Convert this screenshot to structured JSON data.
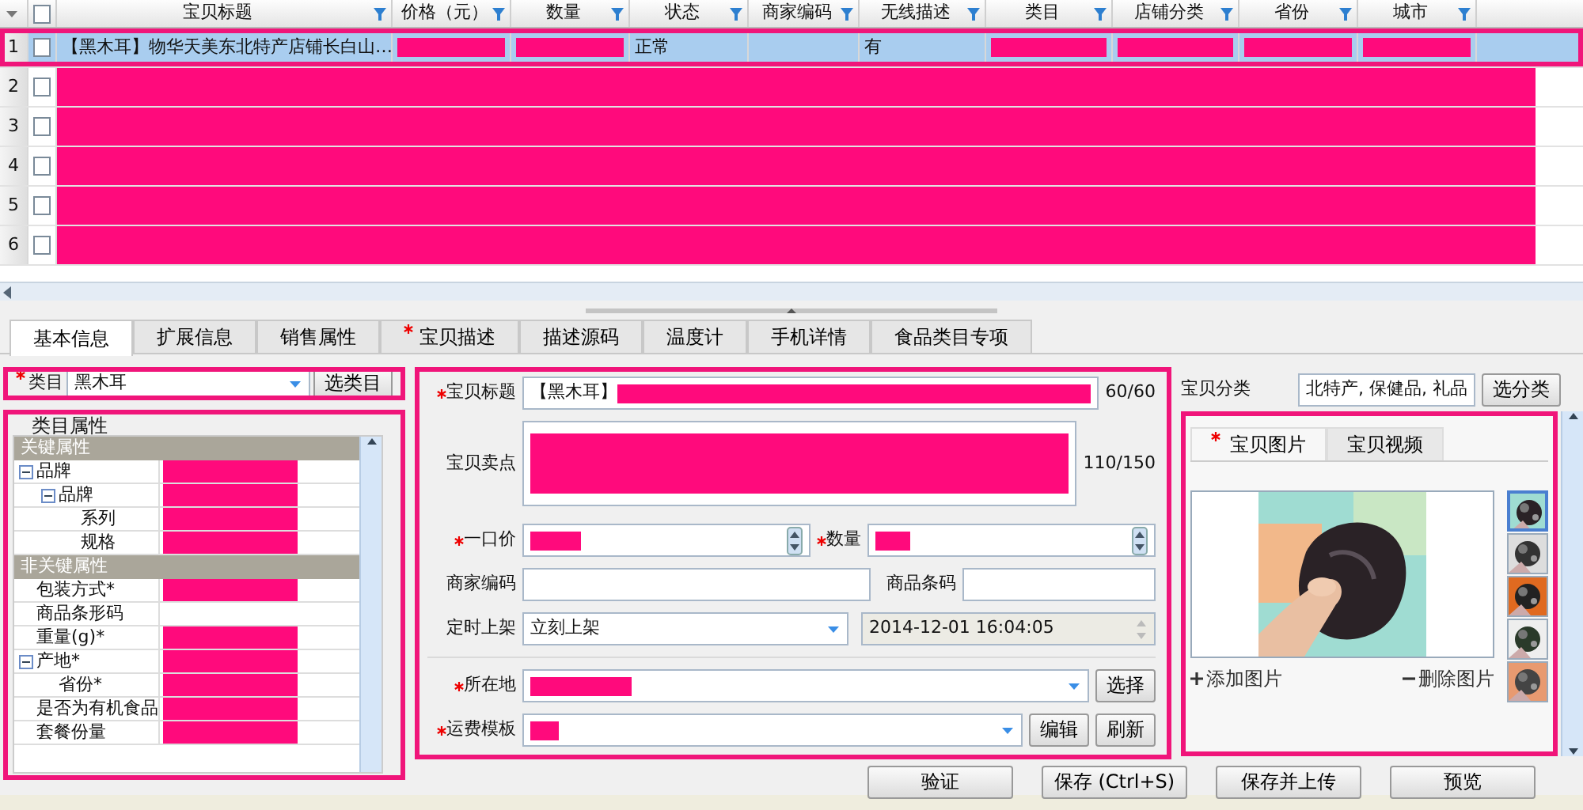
{
  "grid": {
    "select_all_checked": false,
    "columns": [
      "宝贝标题",
      "价格（元）",
      "数量",
      "状态",
      "商家编码",
      "无线描述",
      "类目",
      "店铺分类",
      "省份",
      "城市"
    ],
    "rows": [
      {
        "number": "1",
        "checked": false,
        "selected": true,
        "highlighted": true,
        "redacted": false,
        "cells": [
          {
            "text": "【黑木耳】物华天美东北特产店铺长白山…",
            "redacted": false
          },
          {
            "redacted": true
          },
          {
            "redacted": true
          },
          {
            "text": "正常",
            "redacted": false
          },
          {
            "redacted": false
          },
          {
            "text": "有",
            "redacted": false
          },
          {
            "redacted": true
          },
          {
            "redacted": true
          },
          {
            "redacted": true
          },
          {
            "redacted": true
          }
        ]
      },
      {
        "number": "2",
        "checked": false,
        "selected": false,
        "highlighted": false,
        "redacted": true
      },
      {
        "number": "3",
        "checked": false,
        "selected": false,
        "highlighted": false,
        "redacted": true
      },
      {
        "number": "4",
        "checked": false,
        "selected": false,
        "highlighted": false,
        "redacted": true
      },
      {
        "number": "5",
        "checked": false,
        "selected": false,
        "highlighted": false,
        "redacted": true
      },
      {
        "number": "6",
        "checked": false,
        "selected": false,
        "highlighted": false,
        "redacted": true
      }
    ]
  },
  "tabs": [
    {
      "label": "基本信息",
      "selected": true,
      "required": false
    },
    {
      "label": "扩展信息",
      "selected": false,
      "required": false
    },
    {
      "label": "销售属性",
      "selected": false,
      "required": false
    },
    {
      "label": "宝贝描述",
      "selected": false,
      "required": true
    },
    {
      "label": "描述源码",
      "selected": false,
      "required": false
    },
    {
      "label": "温度计",
      "selected": false,
      "required": false
    },
    {
      "label": "手机详情",
      "selected": false,
      "required": false
    },
    {
      "label": "食品类目专项",
      "selected": false,
      "required": false
    }
  ],
  "category_field": {
    "label": "类目",
    "required": true,
    "value": "黑木耳",
    "button": "选类目",
    "highlighted": true
  },
  "attributes": {
    "legend": "类目属性",
    "highlighted": true,
    "rows": [
      {
        "kind": "group",
        "label": "关键属性"
      },
      {
        "kind": "item",
        "label": "品牌",
        "expanded": true,
        "redacted": true,
        "children": [
          {
            "kind": "item",
            "label": "品牌",
            "expanded": true,
            "redacted": true,
            "children": [
              {
                "kind": "item",
                "label": "系列",
                "redacted": true
              },
              {
                "kind": "item",
                "label": "规格",
                "redacted": true
              }
            ]
          }
        ]
      },
      {
        "kind": "group",
        "label": "非关键属性"
      },
      {
        "kind": "item",
        "label": "包装方式*",
        "redacted": true
      },
      {
        "kind": "item",
        "label": "商品条形码",
        "redacted": false
      },
      {
        "kind": "item",
        "label": "重量(g)*",
        "redacted": true
      },
      {
        "kind": "item",
        "label": "产地*",
        "expanded": true,
        "redacted": true,
        "children": [
          {
            "kind": "item",
            "label": "省份*",
            "redacted": true
          }
        ]
      },
      {
        "kind": "item",
        "label": "是否为有机食品",
        "redacted": true
      },
      {
        "kind": "item",
        "label": "套餐份量",
        "redacted": true
      }
    ]
  },
  "form": {
    "highlighted": true,
    "title": {
      "label": "宝贝标题",
      "required": true,
      "value": "【黑木耳】",
      "redacted": true,
      "counter": "60/60"
    },
    "selling_points": {
      "label": "宝贝卖点",
      "redacted": true,
      "counter": "110/150"
    },
    "price": {
      "label": "一口价",
      "required": true,
      "redacted": true
    },
    "quantity": {
      "label": "数量",
      "required": true,
      "redacted": true
    },
    "merchant_code": {
      "label": "商家编码"
    },
    "barcode": {
      "label": "商品条码"
    },
    "schedule": {
      "label": "定时上架",
      "value": "立刻上架",
      "datetime": "2014-12-01 16:04:05",
      "datetime_disabled": true
    },
    "location": {
      "label": "所在地",
      "required": true,
      "redacted": true,
      "buttons": [
        "选择"
      ]
    },
    "shipping": {
      "label": "运费模板",
      "required": true,
      "redacted": true,
      "buttons": [
        "编辑",
        "刷新"
      ]
    }
  },
  "shop_category": {
    "label": "宝贝分类",
    "value": "北特产, 保健品, 礼品",
    "button": "选分类"
  },
  "media": {
    "highlighted": true,
    "tabs": [
      {
        "label": "宝贝图片",
        "selected": true,
        "required": true
      },
      {
        "label": "宝贝视频",
        "selected": false,
        "required": false
      }
    ],
    "thumbnails": [
      {
        "selected": true
      },
      {
        "selected": false
      },
      {
        "selected": false
      },
      {
        "selected": false
      },
      {
        "selected": false
      }
    ],
    "add_label": "添加图片",
    "remove_label": "删除图片"
  },
  "actions": [
    "验证",
    "保存 (Ctrl+S)",
    "保存并上传",
    "预览"
  ]
}
